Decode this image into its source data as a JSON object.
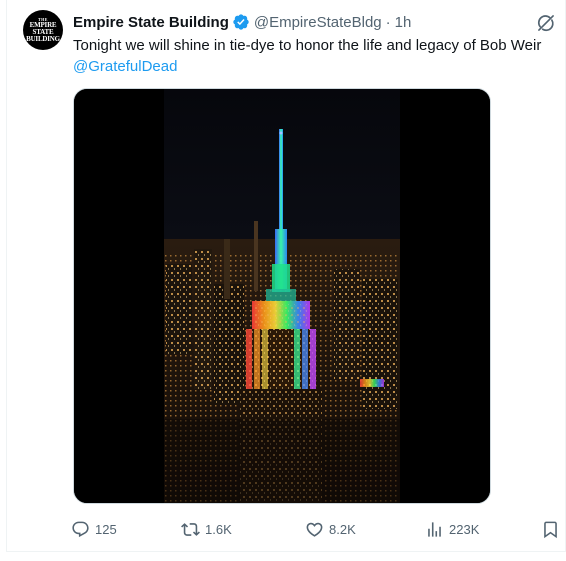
{
  "account": {
    "avatar_line1": "THE",
    "avatar_line2": "EMPIRE",
    "avatar_line3": "STATE",
    "avatar_line4": "BUILDING",
    "display_name": "Empire State Building",
    "handle": "@EmpireStateBldg",
    "separator": "·",
    "time": "1h",
    "verified": true
  },
  "tweet": {
    "text": "Tonight we will shine in tie-dye to honor the life and legacy of Bob Weir",
    "mention": "@GratefulDead"
  },
  "media": {
    "description_icon": "video-thumbnail"
  },
  "actions": {
    "replies": "125",
    "reposts": "1.6K",
    "likes": "8.2K",
    "views": "223K"
  },
  "icons": {
    "grok": "grok-icon",
    "reply": "reply-icon",
    "retweet": "retweet-icon",
    "like": "heart-icon",
    "views": "views-icon",
    "bookmark": "bookmark-icon",
    "verified": "verified-badge-icon"
  },
  "colors": {
    "text": "#0f1419",
    "muted": "#536471",
    "link": "#1d9bf0",
    "verified": "#1d9bf0",
    "border": "#eff3f4"
  }
}
